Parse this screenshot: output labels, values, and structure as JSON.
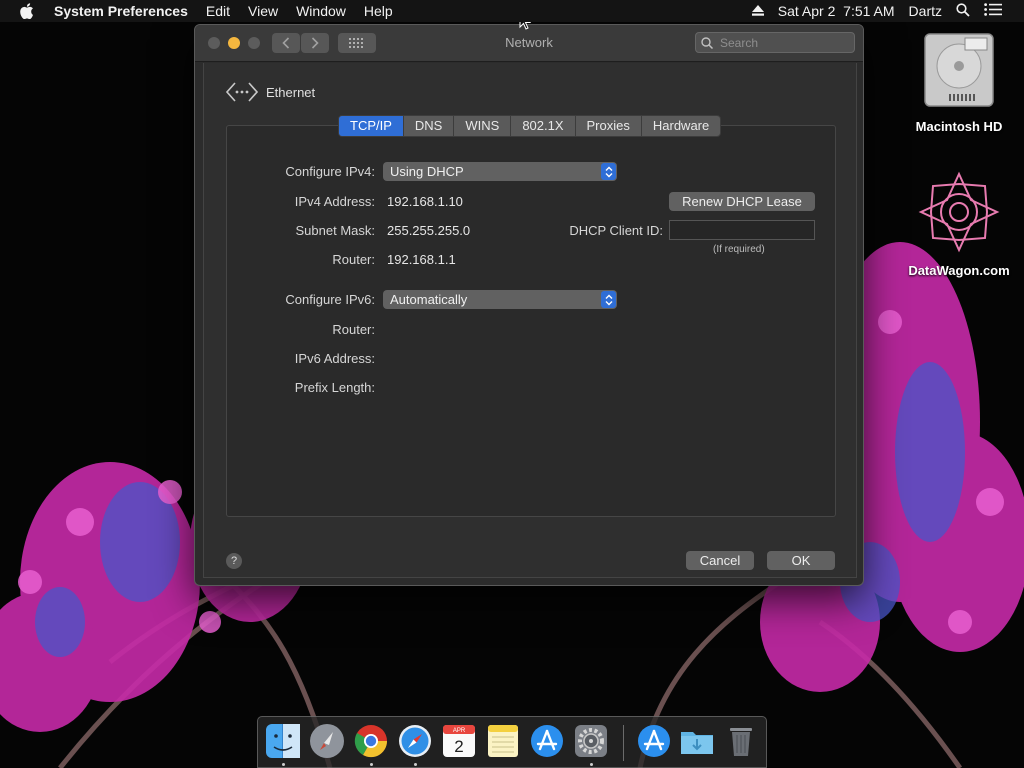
{
  "menubar": {
    "app_name": "System Preferences",
    "menus": [
      "Edit",
      "View",
      "Window",
      "Help"
    ],
    "datetime": "Sat Apr 2  7:51 AM",
    "user": "Dartz"
  },
  "desktop": {
    "icons": [
      {
        "label": "Macintosh HD",
        "icon": "hard-drive-icon"
      },
      {
        "label": "DataWagon.com",
        "icon": "pink-geometric-logo-icon"
      }
    ]
  },
  "window": {
    "title": "Network",
    "search_placeholder": "Search",
    "interface_name": "Ethernet",
    "tabs": [
      {
        "label": "TCP/IP",
        "active": true
      },
      {
        "label": "DNS",
        "active": false
      },
      {
        "label": "WINS",
        "active": false
      },
      {
        "label": "802.1X",
        "active": false
      },
      {
        "label": "Proxies",
        "active": false
      },
      {
        "label": "Hardware",
        "active": false
      }
    ],
    "ipv4": {
      "configure_label": "Configure IPv4:",
      "configure_value": "Using DHCP",
      "address_label": "IPv4 Address:",
      "address_value": "192.168.1.10",
      "subnet_label": "Subnet Mask:",
      "subnet_value": "255.255.255.0",
      "router_label": "Router:",
      "router_value": "192.168.1.1"
    },
    "dhcp": {
      "renew_button": "Renew DHCP Lease",
      "client_id_label": "DHCP Client ID:",
      "client_id_value": "",
      "client_id_note": "(If required)"
    },
    "ipv6": {
      "configure_label": "Configure IPv6:",
      "configure_value": "Automatically",
      "router_label": "Router:",
      "address_label": "IPv6 Address:",
      "prefix_label": "Prefix Length:"
    },
    "help_glyph": "?",
    "cancel_button": "Cancel",
    "ok_button": "OK"
  },
  "dock": {
    "items": [
      "finder",
      "launchpad",
      "chrome",
      "safari",
      "calendar",
      "notes",
      "app-store",
      "system-preferences",
      "app-store-2",
      "downloads-folder",
      "trash"
    ],
    "calendar": {
      "month": "APR",
      "day": "2"
    }
  },
  "colors": {
    "accent_blue": "#2f6ed6",
    "window_bg": "#2c2c2c",
    "minimize_yellow": "#f4b73f"
  }
}
